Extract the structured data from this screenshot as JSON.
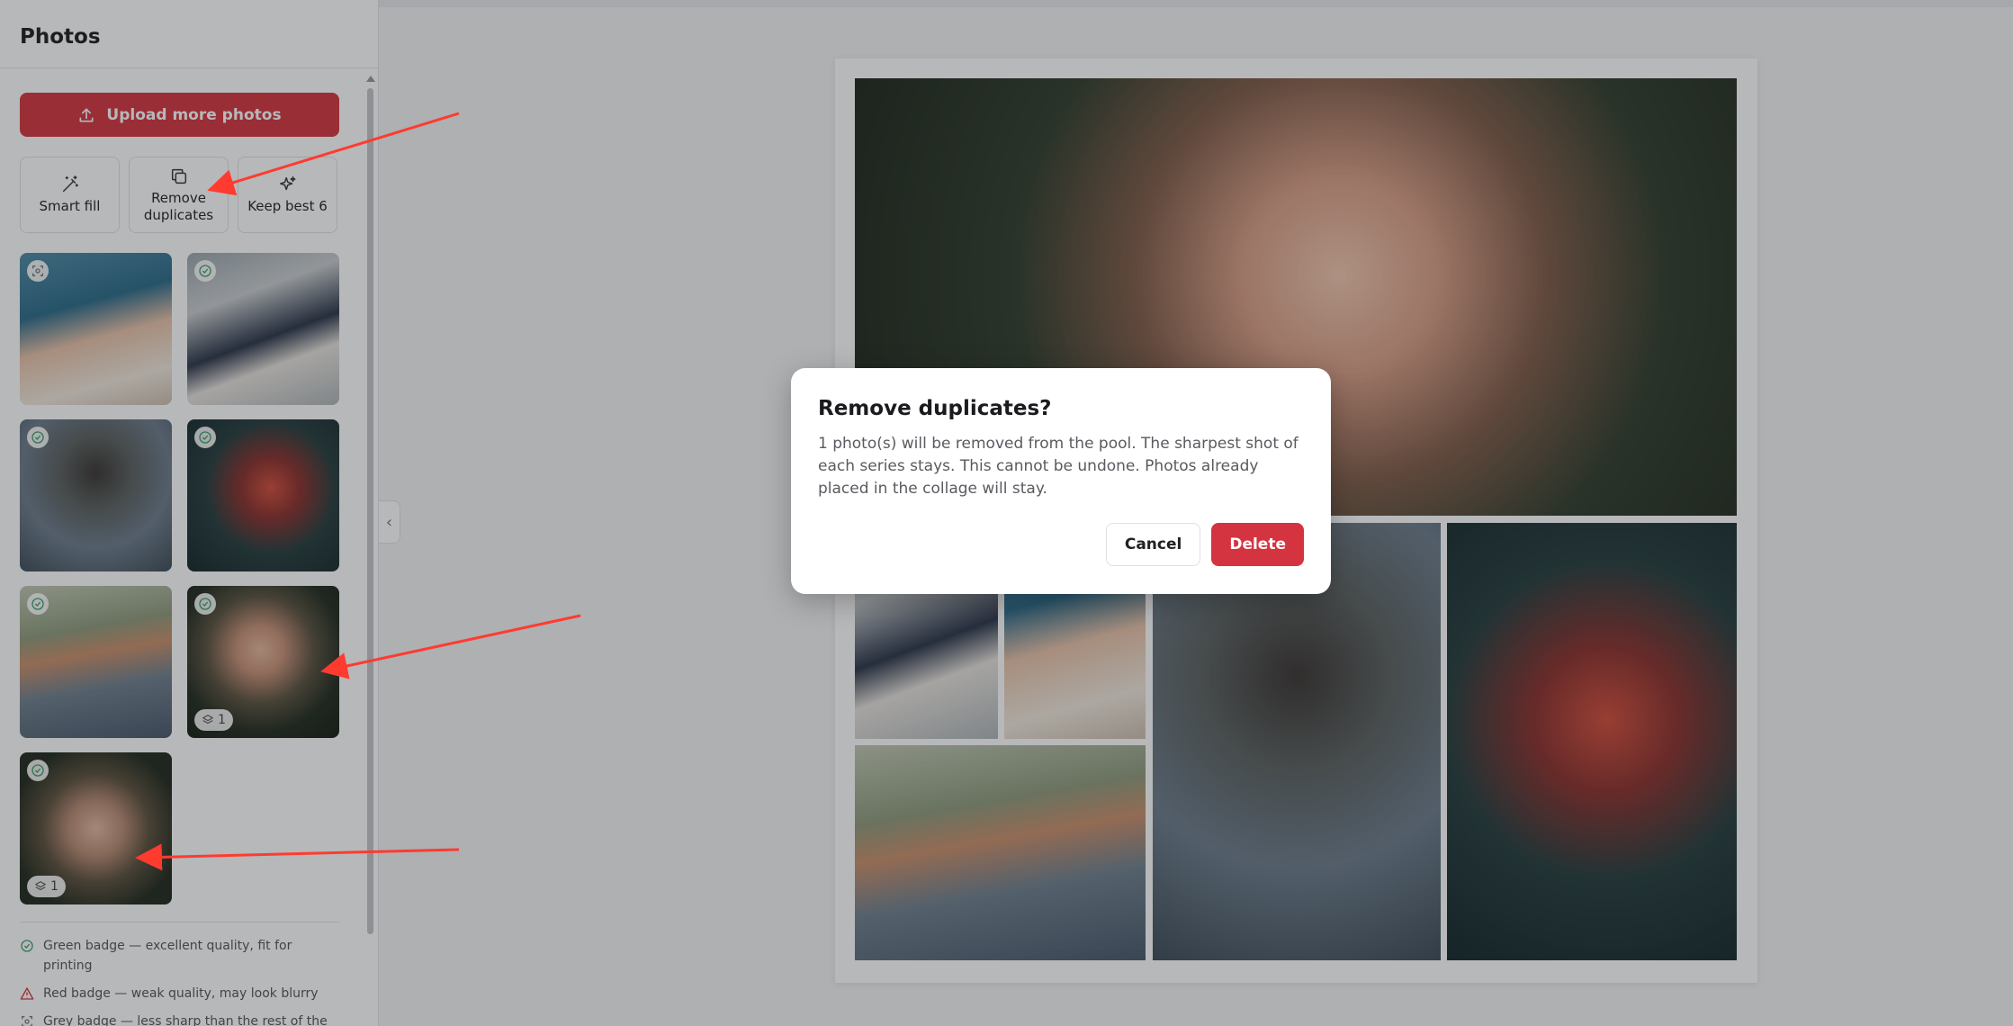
{
  "sidebar": {
    "title": "Photos",
    "upload_label": "Upload more photos",
    "tools": [
      {
        "label": "Smart fill",
        "icon": "magic-wand-icon"
      },
      {
        "label": "Remove duplicates",
        "icon": "copy-icon"
      },
      {
        "label": "Keep best 6",
        "icon": "sparkles-icon"
      }
    ],
    "thumbnails": [
      {
        "badge": "grey-badge",
        "series": ""
      },
      {
        "badge": "green-badge",
        "series": ""
      },
      {
        "badge": "green-badge",
        "series": ""
      },
      {
        "badge": "green-badge",
        "series": ""
      },
      {
        "badge": "green-badge",
        "series": ""
      },
      {
        "badge": "green-badge",
        "series": "1"
      },
      {
        "badge": "green-badge",
        "series": "1"
      }
    ],
    "legend": [
      {
        "text": "Green badge — excellent quality, fit for printing",
        "icon": "check-circle-icon",
        "color": "#3a9b6a"
      },
      {
        "text": "Red badge — weak quality, may look blurry",
        "icon": "warning-triangle-icon",
        "color": "#d4343f"
      },
      {
        "text": "Grey badge — less sharp than the rest of the",
        "icon": "focus-icon",
        "color": "#777777"
      }
    ]
  },
  "modal": {
    "title": "Remove duplicates?",
    "body": "1 photo(s) will be removed from the pool. The sharpest shot of each series stays. This cannot be undone. Photos already placed in the collage will stay.",
    "cancel_label": "Cancel",
    "delete_label": "Delete"
  },
  "colors": {
    "accent": "#d4343f",
    "green_badge": "#3a9b6a"
  }
}
